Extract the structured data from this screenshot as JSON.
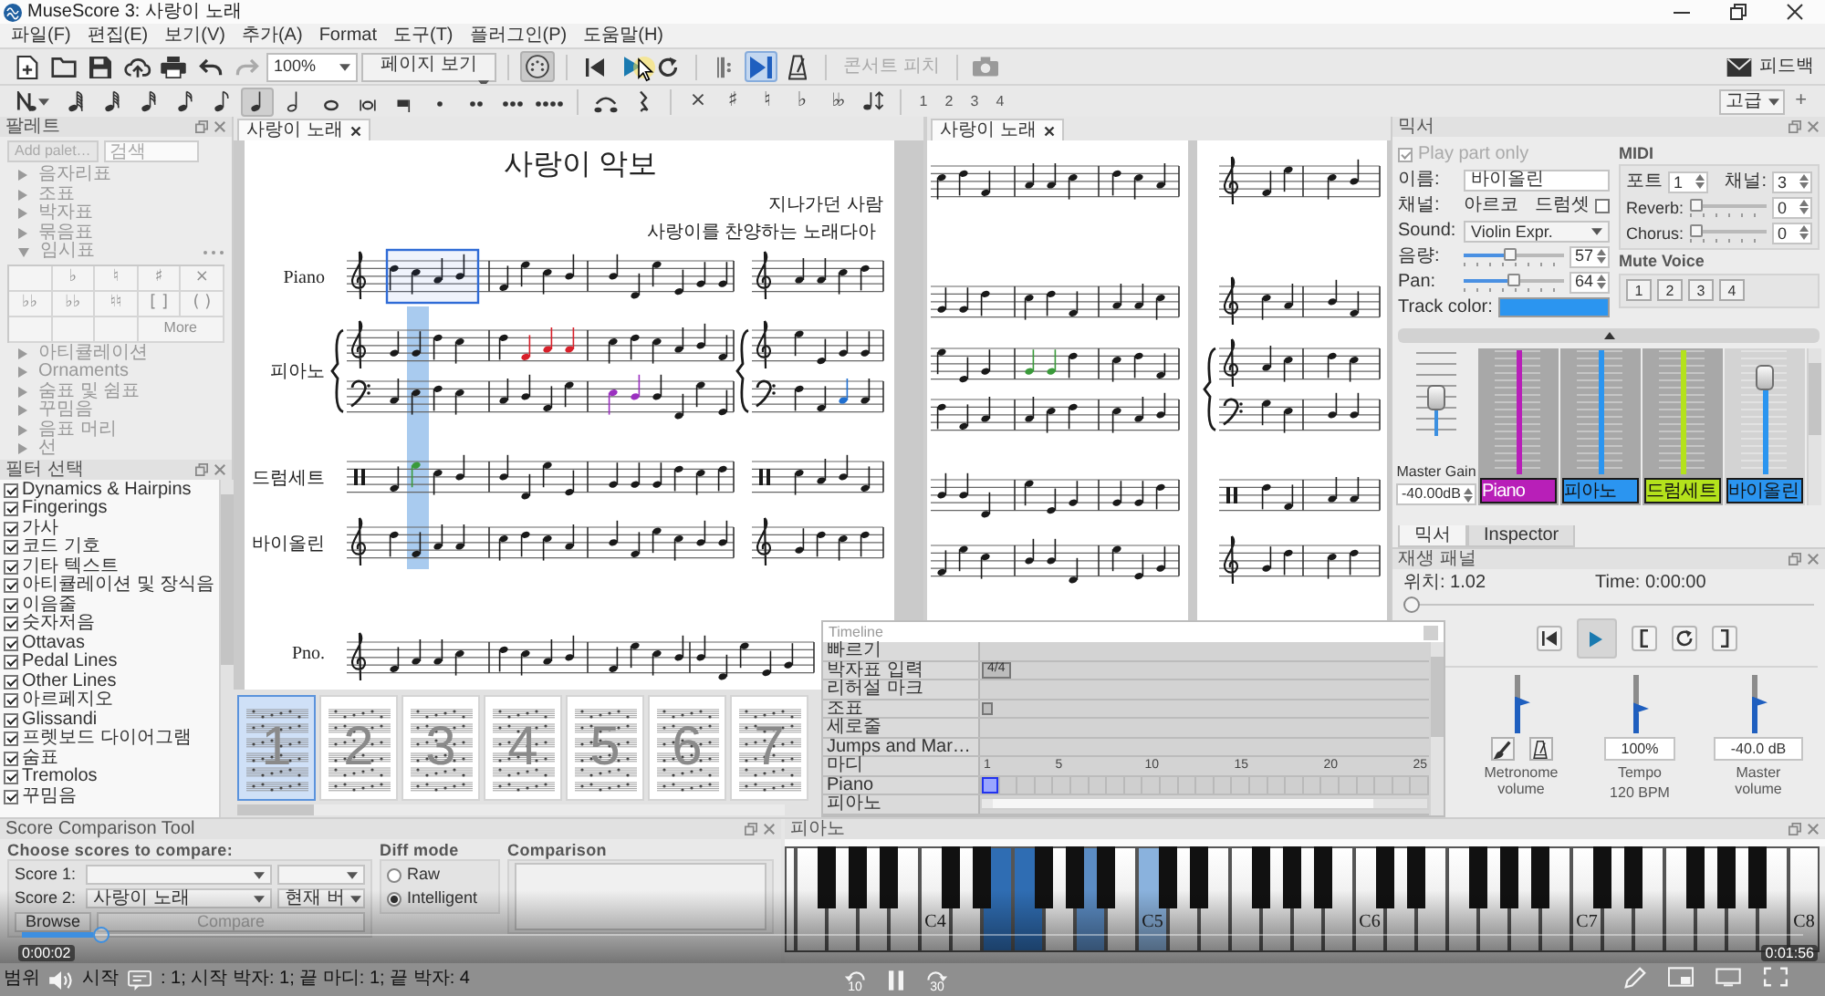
{
  "window": {
    "title": "MuseScore 3: 사랑이 노래"
  },
  "menu": [
    "파일(F)",
    "편집(E)",
    "보기(V)",
    "추가(A)",
    "Format",
    "도구(T)",
    "플러그인(P)",
    "도움말(H)"
  ],
  "main_toolbar": {
    "zoom": "100%",
    "view_mode": "페이지 보기",
    "midi_input": {
      "on": true
    },
    "loop": {
      "on": false
    },
    "play_repeats": {
      "on": false
    },
    "pan": {
      "on": true
    },
    "metronome": {
      "on": false
    },
    "concert_pitch": {
      "label": "콘서트 피치",
      "disabled": true
    },
    "feedback": "피드백"
  },
  "note_toolbar": {
    "durations": [
      {
        "kind": "hundredtwentyeighth",
        "selected": false
      },
      {
        "kind": "sixtyfourth",
        "selected": false
      },
      {
        "kind": "thirtysecond",
        "selected": false
      },
      {
        "kind": "sixteenth",
        "selected": false
      },
      {
        "kind": "eighth",
        "selected": false
      },
      {
        "kind": "quarter",
        "selected": true
      },
      {
        "kind": "half",
        "selected": false
      },
      {
        "kind": "whole",
        "selected": false
      },
      {
        "kind": "breve",
        "selected": false
      },
      {
        "kind": "longa",
        "selected": false
      }
    ],
    "accidentals": [
      {
        "kind": "doublesharp",
        "glyph": "×"
      },
      {
        "kind": "sharp",
        "glyph": "♯"
      },
      {
        "kind": "natural",
        "glyph": "♮"
      },
      {
        "kind": "flat",
        "glyph": "♭"
      },
      {
        "kind": "doubleflat",
        "glyph": "♭♭"
      }
    ],
    "voices": [
      "1",
      "2",
      "3",
      "4"
    ],
    "workspace": "고급",
    "add_workspace": "+"
  },
  "palette": {
    "title": "팔레트",
    "add_button": "Add palet…",
    "search": {
      "placeholder": "검색"
    },
    "sections": [
      {
        "label": "음자리표",
        "expanded": false
      },
      {
        "label": "조표",
        "expanded": false
      },
      {
        "label": "박자표",
        "expanded": false
      },
      {
        "label": "묶음표",
        "expanded": false
      },
      {
        "label": "임시표",
        "expanded": true,
        "cells": [
          "♭",
          "♮",
          "♯",
          "×",
          "♭♭",
          "♭♭",
          "♮♮",
          "[ ]",
          "( )"
        ],
        "more": "More"
      },
      {
        "label": "아티큘레이션",
        "expanded": false
      },
      {
        "label": "Ornaments",
        "expanded": false
      },
      {
        "label": "숨표 및 쉼표",
        "expanded": false
      },
      {
        "label": "꾸밈음",
        "expanded": false
      },
      {
        "label": "음표 머리",
        "expanded": false
      },
      {
        "label": "선",
        "expanded": false
      }
    ]
  },
  "selection_filter": {
    "title": "필터 선택",
    "items": [
      {
        "label": "Dynamics & Hairpins",
        "checked": true
      },
      {
        "label": "Fingerings",
        "checked": true
      },
      {
        "label": "가사",
        "checked": true
      },
      {
        "label": "코드 기호",
        "checked": true
      },
      {
        "label": "기타 텍스트",
        "checked": true
      },
      {
        "label": "아티큘레이션 및 장식음",
        "checked": true
      },
      {
        "label": "이음줄",
        "checked": true
      },
      {
        "label": "숫자저음",
        "checked": true
      },
      {
        "label": "Ottavas",
        "checked": true
      },
      {
        "label": "Pedal Lines",
        "checked": true
      },
      {
        "label": "Other Lines",
        "checked": true
      },
      {
        "label": "아르페지오",
        "checked": true
      },
      {
        "label": "Glissandi",
        "checked": true
      },
      {
        "label": "프렛보드 다이어그램",
        "checked": true
      },
      {
        "label": "숨표",
        "checked": true
      },
      {
        "label": "Tremolos",
        "checked": true
      },
      {
        "label": "꾸밈음",
        "checked": true
      }
    ]
  },
  "views": [
    {
      "tab": "사랑이 노래",
      "score": {
        "title": "사랑이 악보",
        "composer": "지나가던 사람",
        "subtitle": "사랑이를 찬양하는 노래다아",
        "staves": [
          {
            "label": "Piano",
            "kind": "treble",
            "selected": true
          },
          {
            "label": "피아노",
            "kind": "grand",
            "selected": false
          },
          {
            "label": "드럼세트",
            "kind": "percussion",
            "selected": false
          },
          {
            "label": "바이올린",
            "kind": "treble",
            "selected": false
          }
        ],
        "next_system": {
          "label": "Pno.",
          "kind": "treble"
        }
      },
      "navigator": {
        "pages": [
          {
            "label": "1",
            "selected": true
          },
          {
            "label": "2",
            "selected": false
          },
          {
            "label": "3",
            "selected": false
          },
          {
            "label": "4",
            "selected": false
          },
          {
            "label": "5",
            "selected": false
          },
          {
            "label": "6",
            "selected": false
          },
          {
            "label": "7",
            "selected": false
          }
        ]
      }
    },
    {
      "tab": "사랑이 노래"
    }
  ],
  "timeline": {
    "title": "Timeline",
    "rows": [
      {
        "label": "빠르기",
        "kind": "plain"
      },
      {
        "label": "박자표 입력",
        "kind": "marker",
        "marker": "4/4"
      },
      {
        "label": "리허설 마크",
        "kind": "plain"
      },
      {
        "label": "조표",
        "kind": "key"
      },
      {
        "label": "세로줄",
        "kind": "plain"
      },
      {
        "label": "Jumps and Mar…",
        "kind": "plain"
      },
      {
        "label": "마디",
        "kind": "ruler",
        "numbers": [
          "1",
          "5",
          "10",
          "15",
          "20",
          "25"
        ]
      },
      {
        "label": "Piano",
        "kind": "track",
        "selected": true
      },
      {
        "label": "피아노",
        "kind": "plain"
      }
    ]
  },
  "mixer": {
    "title": "믹서",
    "play_part_only": {
      "label": "Play part only",
      "checked": true,
      "disabled": true
    },
    "name": {
      "label": "이름:",
      "value": "바이올린"
    },
    "channel": {
      "label": "채널:",
      "value": "아르코"
    },
    "drumset": {
      "label": "드럼셋",
      "checked": false
    },
    "sound": {
      "label": "Sound:",
      "value": "Violin Expr."
    },
    "volume": {
      "label": "음량:",
      "level": 0.45,
      "value": "57"
    },
    "pan": {
      "label": "Pan:",
      "level": 0.5,
      "value": "64"
    },
    "track_color": {
      "label": "Track color:",
      "color": "#2b95f0"
    },
    "midi": {
      "title": "MIDI",
      "port": {
        "label": "포트",
        "value": "1"
      },
      "channel": {
        "label": "채널:",
        "value": "3"
      },
      "reverb": {
        "label": "Reverb:",
        "level": 0,
        "value": "0"
      },
      "chorus": {
        "label": "Chorus:",
        "level": 0,
        "value": "0"
      }
    },
    "mute_voice": {
      "title": "Mute Voice",
      "voices": [
        "1",
        "2",
        "3",
        "4"
      ]
    },
    "master_gain": {
      "label": "Master Gain",
      "level": 0.45,
      "value": "-40.00dB"
    },
    "strips": [
      {
        "name": "Piano",
        "color": "#b81fb8",
        "level": 1,
        "selected": false
      },
      {
        "name": "피아노",
        "color": "#2b95f0",
        "level": 1,
        "selected": false
      },
      {
        "name": "드럼세트",
        "color": "#b4e21c",
        "level": 1,
        "selected": false
      },
      {
        "name": "바이올린",
        "color": "#2b95f0",
        "level": 0.86,
        "selected": true
      }
    ],
    "tabs": [
      {
        "label": "믹서",
        "selected": true
      },
      {
        "label": "Inspector",
        "selected": false
      }
    ]
  },
  "play_panel": {
    "title": "재생 패널",
    "position": "위치: 1.02",
    "time": "Time: 0:00:00",
    "level": 0,
    "sliders": [
      {
        "kind": "metronome",
        "label": "Metronome volume",
        "level": 0.5
      },
      {
        "kind": "tempo",
        "label": "Tempo",
        "sublabel": "120 BPM",
        "value": "100%",
        "level": 0.35
      },
      {
        "kind": "master",
        "label": "Master volume",
        "value": "-40.0 dB",
        "level": 0.5
      }
    ]
  },
  "comparison": {
    "title": "Score Comparison Tool",
    "choose": {
      "title": "Choose scores to compare:",
      "rows": [
        {
          "label": "Score 1:"
        },
        {
          "label": "Score 2:",
          "value": "사랑이 노래",
          "version": "현재 버"
        }
      ],
      "browse": "Browse",
      "compare": {
        "label": "Compare",
        "disabled": true
      }
    },
    "diff_mode": {
      "title": "Diff mode",
      "options": [
        {
          "label": "Raw",
          "selected": false
        },
        {
          "label": "Intelligent",
          "selected": true
        }
      ]
    },
    "output": {
      "title": "Comparison"
    }
  },
  "keyboard": {
    "title": "피아노",
    "white_keys": [
      {
        "pressed": false
      },
      {
        "pressed": false
      },
      {
        "pressed": false
      },
      {
        "pressed": false
      },
      {
        "pressed": false
      },
      {
        "label": "C4",
        "pressed": false
      },
      {
        "pressed": false
      },
      {
        "pressed": true,
        "color": "#2f6db3"
      },
      {
        "pressed": true,
        "color": "#2f6db3"
      },
      {
        "pressed": false
      },
      {
        "pressed": true,
        "color": "#5b8cc4"
      },
      {
        "pressed": false
      },
      {
        "label": "C5",
        "pressed": true,
        "color": "#8ab2dd"
      },
      {
        "pressed": false
      },
      {
        "pressed": false
      },
      {
        "pressed": false
      },
      {
        "pressed": false
      },
      {
        "pressed": false
      },
      {
        "pressed": false
      },
      {
        "label": "C6",
        "pressed": false
      },
      {
        "pressed": false
      },
      {
        "pressed": false
      },
      {
        "pressed": false
      },
      {
        "pressed": false
      },
      {
        "pressed": false
      },
      {
        "pressed": false
      },
      {
        "label": "C7",
        "pressed": false
      },
      {
        "pressed": false
      },
      {
        "pressed": false
      },
      {
        "pressed": false
      },
      {
        "pressed": false
      },
      {
        "pressed": false
      },
      {
        "pressed": false
      },
      {
        "label": "C8",
        "pressed": false
      }
    ]
  },
  "status_bar": [
    "범위",
    "시작",
    ": 1; 시작 박자: 1; 끝 마디: 1; 끝 박자: 4"
  ],
  "video_player": {
    "elapsed": "0:00:02",
    "duration": "0:01:56",
    "level": 0.04,
    "skip_back": "10",
    "skip_forward": "30"
  }
}
